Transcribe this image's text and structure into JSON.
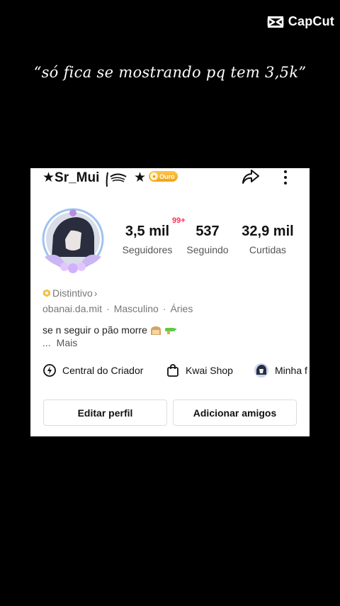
{
  "watermark": {
    "brand": "CapCut",
    "icon": "capcut-logo-icon"
  },
  "caption": "“só fica se mostrando pq tem 3,5k”",
  "profile": {
    "username": "★Sr_Mui",
    "username_suffix": "★",
    "badge": {
      "label": "Ouro",
      "icon": "gold-coin-icon"
    },
    "notification_count": "99+",
    "stats": [
      {
        "value": "3,5 mil",
        "label": "Seguidores"
      },
      {
        "value": "537",
        "label": "Seguindo"
      },
      {
        "value": "32,9 mil",
        "label": "Curtidas"
      }
    ],
    "distintivo": "Distintivo",
    "meta": {
      "handle": "obanai.da.mit",
      "gender": "Masculino",
      "sign": "Áries",
      "separator": "·"
    },
    "bio": "se n seguir o pão morre",
    "more": {
      "ellipsis": "...",
      "label": "Mais"
    },
    "shortcuts": [
      {
        "label": "Central do Criador",
        "icon": "creator-center-icon"
      },
      {
        "label": "Kwai Shop",
        "icon": "shopping-bag-icon"
      },
      {
        "label": "Minha f",
        "icon": "avatar-thumb-icon"
      }
    ],
    "buttons": {
      "edit": "Editar perfil",
      "add_friends": "Adicionar amigos"
    },
    "colors": {
      "accent_red": "#ff2d55",
      "badge_gold": "#f0a316"
    }
  }
}
